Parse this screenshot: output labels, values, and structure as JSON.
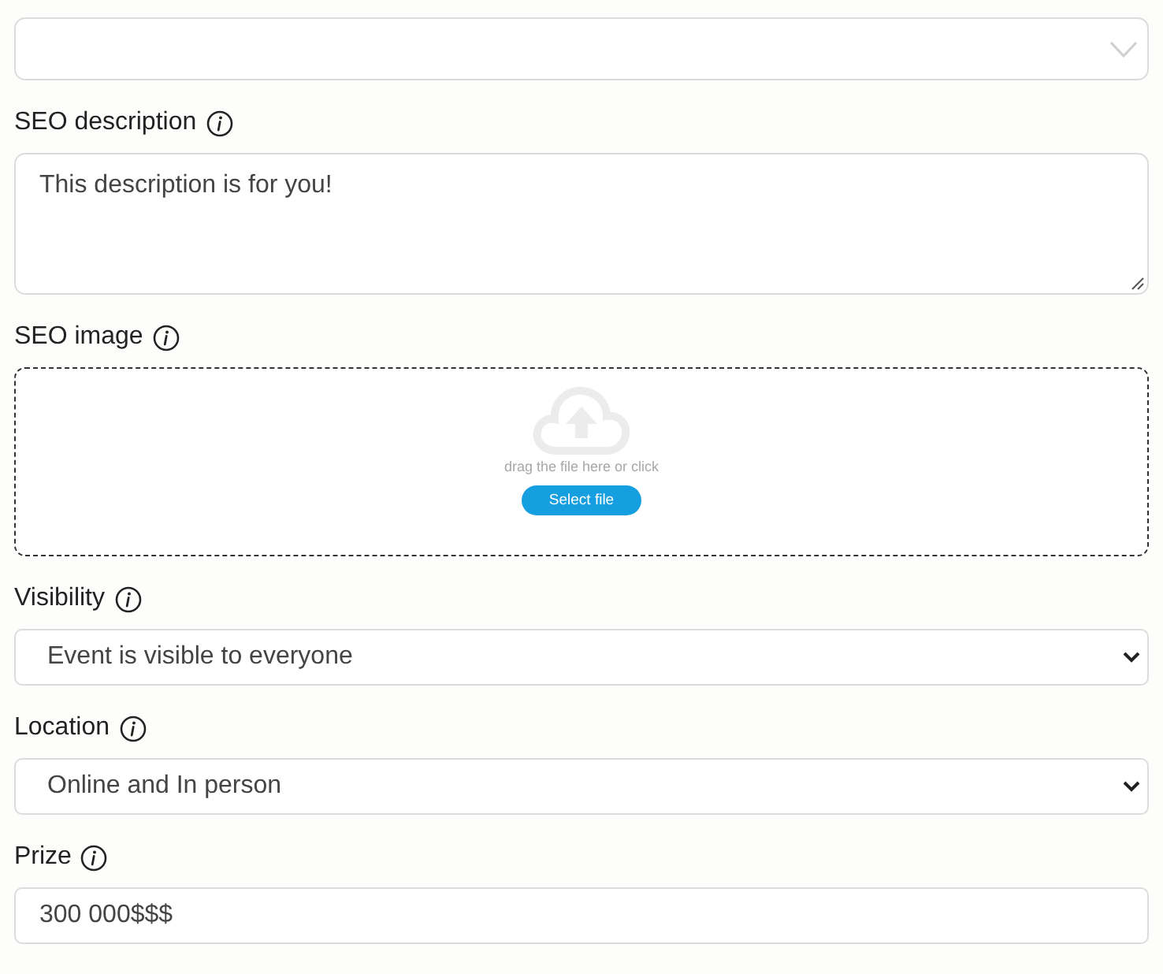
{
  "fields": [
    {
      "kind": "dropdown"
    },
    {
      "kind": "textarea",
      "label": "SEO description",
      "value": "This description is for you!"
    },
    {
      "kind": "upload",
      "label": "SEO image",
      "hint": "drag the file here or click",
      "button": "Select file"
    },
    {
      "kind": "select",
      "label": "Visibility",
      "value": "Event is visible to everyone"
    },
    {
      "kind": "select",
      "label": "Location",
      "value": "Online and In person"
    },
    {
      "kind": "input",
      "label": "Prize",
      "value": "300 000$$$"
    }
  ]
}
